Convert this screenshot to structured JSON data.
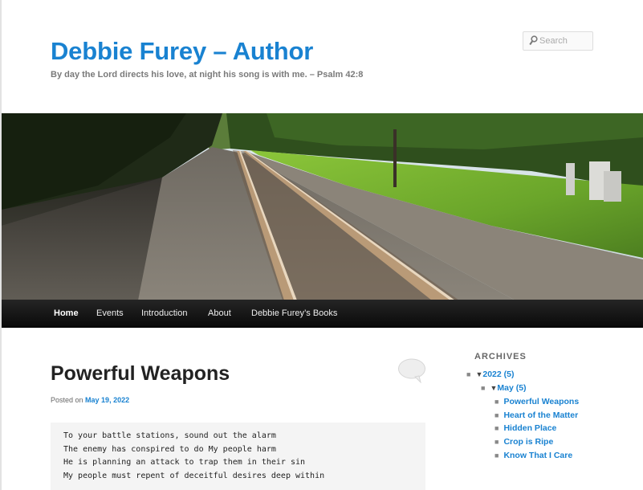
{
  "header": {
    "site_title": "Debbie Furey – Author",
    "site_description": "By day the Lord directs his love, at night his song is with me. – Psalm 42:8",
    "search_placeholder": "Search"
  },
  "nav": {
    "items": [
      {
        "label": "Home"
      },
      {
        "label": "Events"
      },
      {
        "label": "Introduction"
      },
      {
        "label": "About"
      },
      {
        "label": "Debbie Furey’s Books"
      }
    ]
  },
  "post": {
    "title": "Powerful Weapons",
    "posted_on_label": "Posted on",
    "date": "May 19, 2022",
    "poem_lines": [
      "To your battle stations, sound out the alarm",
      "The enemy has conspired to do My people harm",
      "He is planning an attack to trap them in their sin",
      "My people must repent of deceitful desires deep within"
    ]
  },
  "sidebar": {
    "archives_title": "ARCHIVES",
    "year": {
      "label": "2022 (5)",
      "toggle": "▼"
    },
    "month": {
      "label": "May (5)",
      "toggle": "▼"
    },
    "posts": [
      {
        "label": "Powerful Weapons"
      },
      {
        "label": "Heart of the Matter"
      },
      {
        "label": "Hidden Place"
      },
      {
        "label": "Crop is Ripe"
      },
      {
        "label": "Know That I Care"
      }
    ]
  },
  "colors": {
    "link": "#1982d1",
    "nav_background": "#1a1a1a",
    "page_background": "#ffffff"
  },
  "icons": {
    "search": "search-icon",
    "comment": "comment-bubble-icon",
    "banner": "railroad-track-photo"
  }
}
